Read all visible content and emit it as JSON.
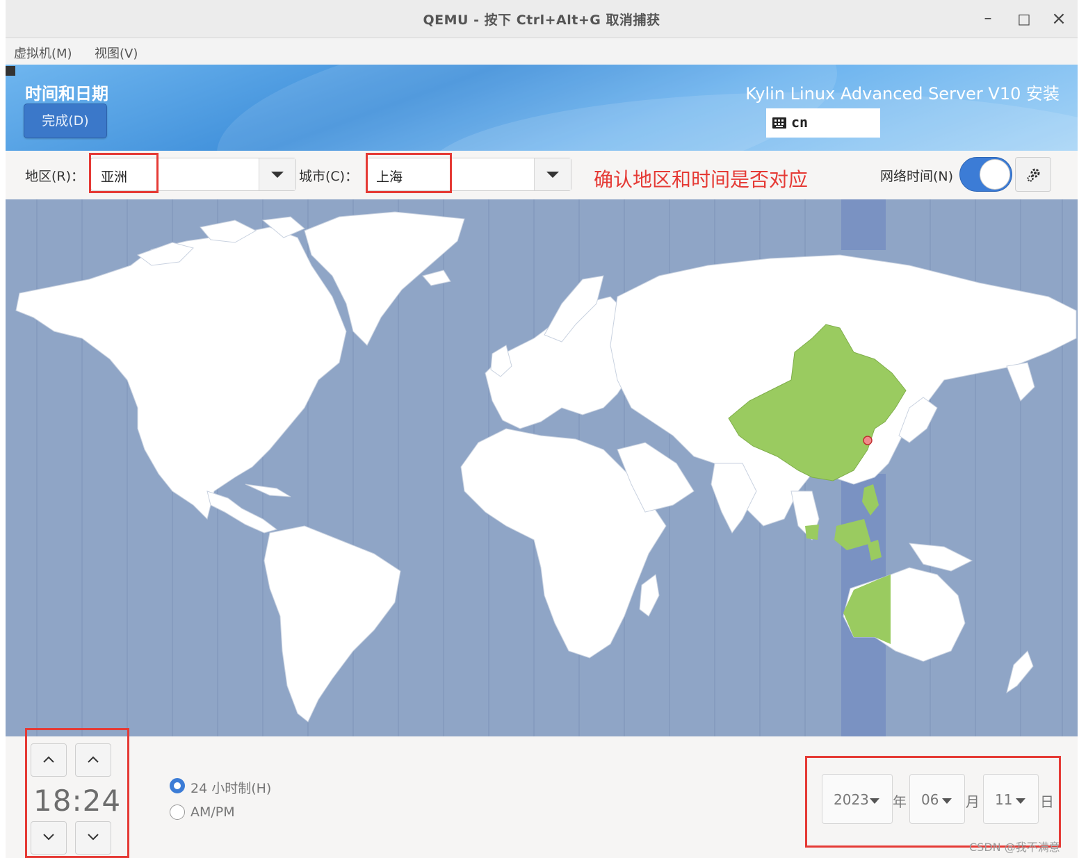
{
  "window": {
    "title": "QEMU - 按下 Ctrl+Alt+G 取消捕获",
    "minimize_glyph": "–",
    "maximize_glyph": "□",
    "close_glyph": "×"
  },
  "menubar": {
    "items": [
      {
        "label": "虚拟机(M)"
      },
      {
        "label": "视图(V)"
      }
    ]
  },
  "header": {
    "page_title": "时间和日期",
    "done_label": "完成(D)",
    "product_title": "Kylin Linux Advanced Server V10 安装",
    "keyboard_layout": "cn",
    "keyboard_icon": "keyboard-icon"
  },
  "timezone": {
    "region_label": "地区(R)：",
    "region_value": "亚洲",
    "city_label": "城市(C)：",
    "city_value": "上海",
    "annotation": "确认地区和时间是否对应",
    "network_time_label": "网络时间(N)",
    "network_time_enabled": true,
    "settings_icon": "gear-icon"
  },
  "colors": {
    "ocean": "#8fa5c6",
    "land": "#ffffff",
    "selected_zone": "#7a92c2",
    "selected_country": "#9acb60",
    "annotation_red": "#e53a35",
    "accent_blue": "#3c7cd6"
  },
  "time": {
    "hours": "18",
    "separator": ":",
    "minutes": "24",
    "format_24h_label": "24 小时制(H)",
    "format_ampm_label": "AM/PM",
    "format_selected": "24h"
  },
  "date": {
    "year": "2023",
    "year_unit": "年",
    "month": "06",
    "month_unit": "月",
    "day": "11",
    "day_unit": "日"
  },
  "watermark": "CSDN @我不满意"
}
